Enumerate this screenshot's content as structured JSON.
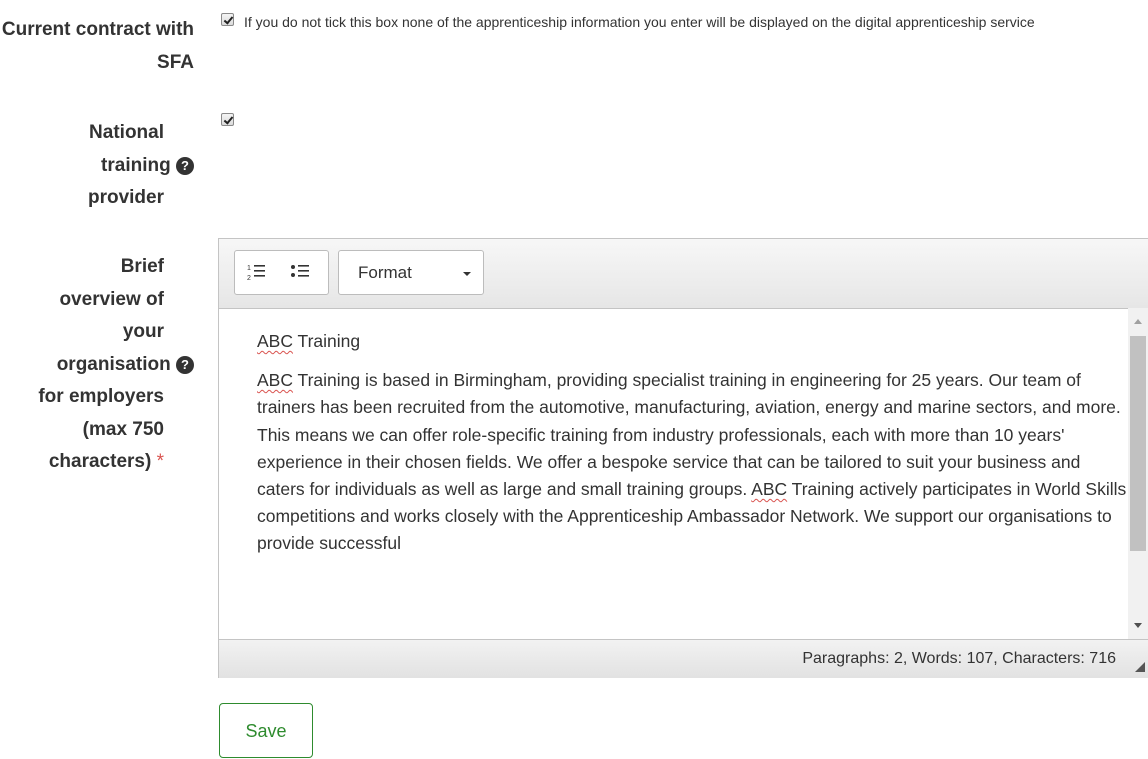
{
  "form": {
    "contract": {
      "label": "Current contract with SFA",
      "checked": true,
      "note": "If you do not tick this box none of the apprenticeship information you enter will be displayed on the digital apprenticeship service"
    },
    "national": {
      "label_line1": "National",
      "label_line2": "training",
      "label_line3": "provider",
      "checked": true,
      "help_icon": "question-circle-icon"
    },
    "overview": {
      "label_lines": [
        "Brief",
        "overview of",
        "your",
        "organisation",
        "for employers",
        "(max 750",
        "characters)"
      ],
      "required_mark": "*",
      "help_icon": "question-circle-icon"
    }
  },
  "editor": {
    "toolbar": {
      "numbered_list_icon": "numbered-list-icon",
      "bullet_list_icon": "bullet-list-icon",
      "format_label": "Format"
    },
    "content": {
      "heading": "ABC Training",
      "paragraph": "ABC Training is based in Birmingham, providing specialist training in engineering for 25 years. Our team of trainers has been recruited from the automotive, manufacturing, aviation, energy and marine sectors, and more. This means we can offer role-specific training from industry professionals, each with more than 10 years' experience in their chosen fields. We offer a bespoke service that can be tailored to suit your business and caters for individuals as well as large and small training groups. ABC Training actively participates in World Skills competitions and works closely with the Apprenticeship Ambassador Network. We support our organisations to provide successful"
    },
    "status": "Paragraphs: 2, Words: 107, Characters: 716"
  },
  "actions": {
    "save_label": "Save"
  },
  "colors": {
    "save_accent": "#2e8b2e",
    "required": "#d9534f"
  }
}
